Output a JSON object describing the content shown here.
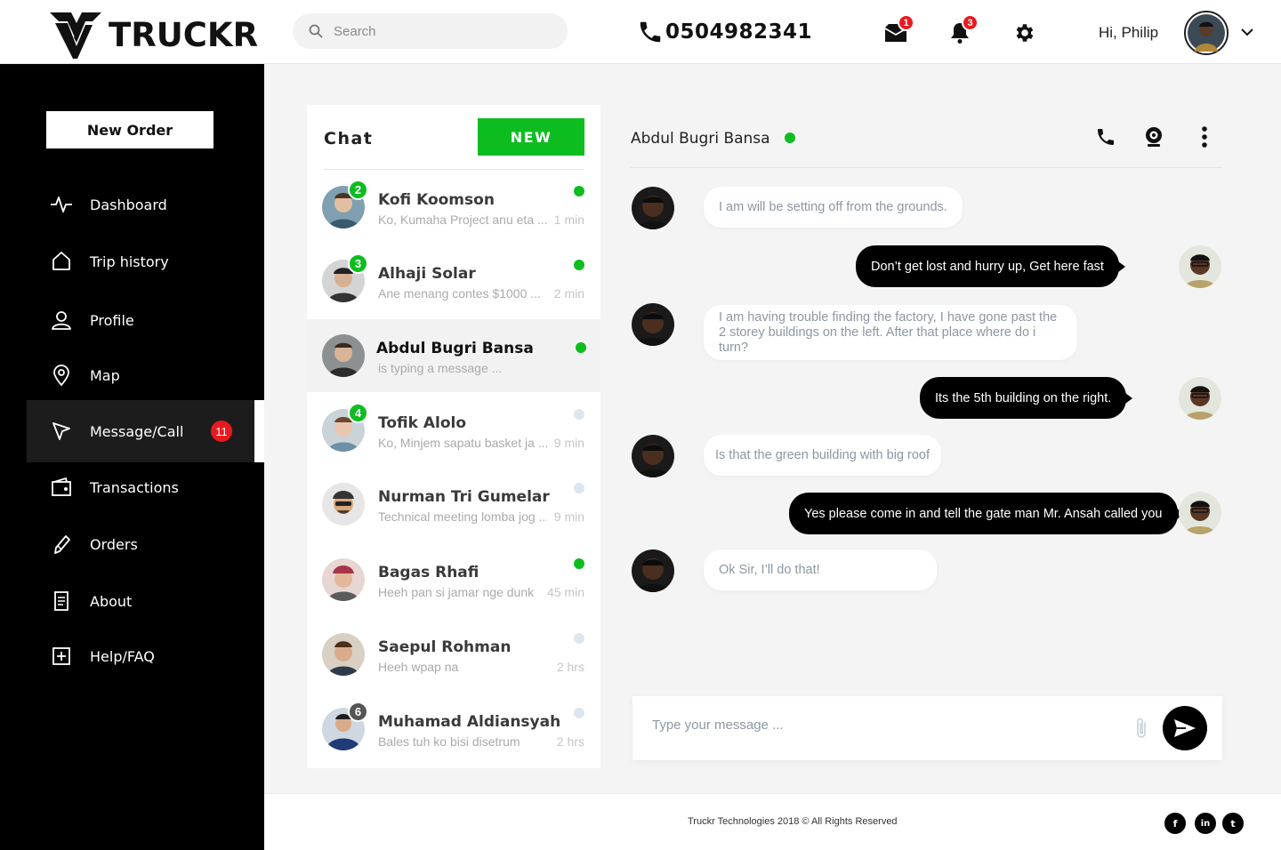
{
  "brand": {
    "name": "TRUCKR"
  },
  "search": {
    "placeholder": "Search"
  },
  "header": {
    "phone": "0504982341",
    "inbox_badge": "1",
    "notifications_badge": "3",
    "greeting": "Hi, Philip"
  },
  "sidebar": {
    "new_order": "New Order",
    "items": [
      {
        "label": "Dashboard",
        "icon": "activity-icon"
      },
      {
        "label": "Trip history",
        "icon": "home-icon"
      },
      {
        "label": "Profile",
        "icon": "user-icon"
      },
      {
        "label": "Map",
        "icon": "map-pin-icon"
      },
      {
        "label": "Message/Call",
        "icon": "navigation-icon",
        "badge": "11",
        "active": true
      },
      {
        "label": "Transactions",
        "icon": "wallet-icon"
      },
      {
        "label": "Orders",
        "icon": "pencil-icon"
      },
      {
        "label": "About",
        "icon": "document-icon"
      },
      {
        "label": "Help/FAQ",
        "icon": "plus-square-icon"
      }
    ]
  },
  "chat_list": {
    "title": "Chat",
    "new_button": "NEW",
    "contacts": [
      {
        "name": "Kofi Koomson",
        "preview": "Ko, Kumaha Project anu eta ...",
        "time": "1 min",
        "badge": "2",
        "online": true
      },
      {
        "name": "Alhaji Solar",
        "preview": "Ane menang contes $1000 ...",
        "time": "2 min",
        "badge": "3",
        "online": true
      },
      {
        "name": "Abdul Bugri Bansa",
        "preview": "is typing a message ...",
        "time": "",
        "badge": "",
        "online": true,
        "active": true
      },
      {
        "name": "Tofik Alolo",
        "preview": "Ko, Minjem sapatu basket ja ...",
        "time": "9 min",
        "badge": "4",
        "online": false
      },
      {
        "name": "Nurman Tri Gumelar",
        "preview": "Technical meeting lomba jog ...",
        "time": "9 min",
        "badge": "",
        "online": false
      },
      {
        "name": "Bagas Rhafi",
        "preview": "Heeh pan si jamar nge dunk",
        "time": "45 min",
        "badge": "",
        "online": true
      },
      {
        "name": "Saepul Rohman",
        "preview": "Heeh wpap na",
        "time": "2 hrs",
        "badge": "",
        "online": false
      },
      {
        "name": "Muhamad Aldiansyah",
        "preview": "Bales tuh ko bisi disetrum",
        "time": "2 hrs",
        "badge": "6",
        "online": false
      }
    ]
  },
  "conversation": {
    "contact_name": "Abdul Bugri Bansa",
    "messages": [
      {
        "from": "them",
        "text": "I am will be setting off from the grounds."
      },
      {
        "from": "me",
        "text": "Don’t get lost and hurry up, Get here fast"
      },
      {
        "from": "them",
        "text": "I am having trouble finding the factory, I have gone past the 2 storey buildings on the left. After that place where do i turn?"
      },
      {
        "from": "me",
        "text": "Its the 5th building on the right."
      },
      {
        "from": "them",
        "text": "Is that the green building with big roof"
      },
      {
        "from": "me",
        "text": "Yes please come in and tell the gate man Mr. Ansah called you"
      },
      {
        "from": "them",
        "text": "Ok Sir, I’ll do that!"
      }
    ],
    "composer_placeholder": "Type your message ..."
  },
  "footer": {
    "copyright": "Truckr Technologies 2018 © All Rights Reserved",
    "social": [
      "f",
      "in",
      "t"
    ]
  },
  "colors": {
    "accent_green": "#0dbd20",
    "badge_red": "#e8191f",
    "sidebar_bg": "#000000"
  }
}
